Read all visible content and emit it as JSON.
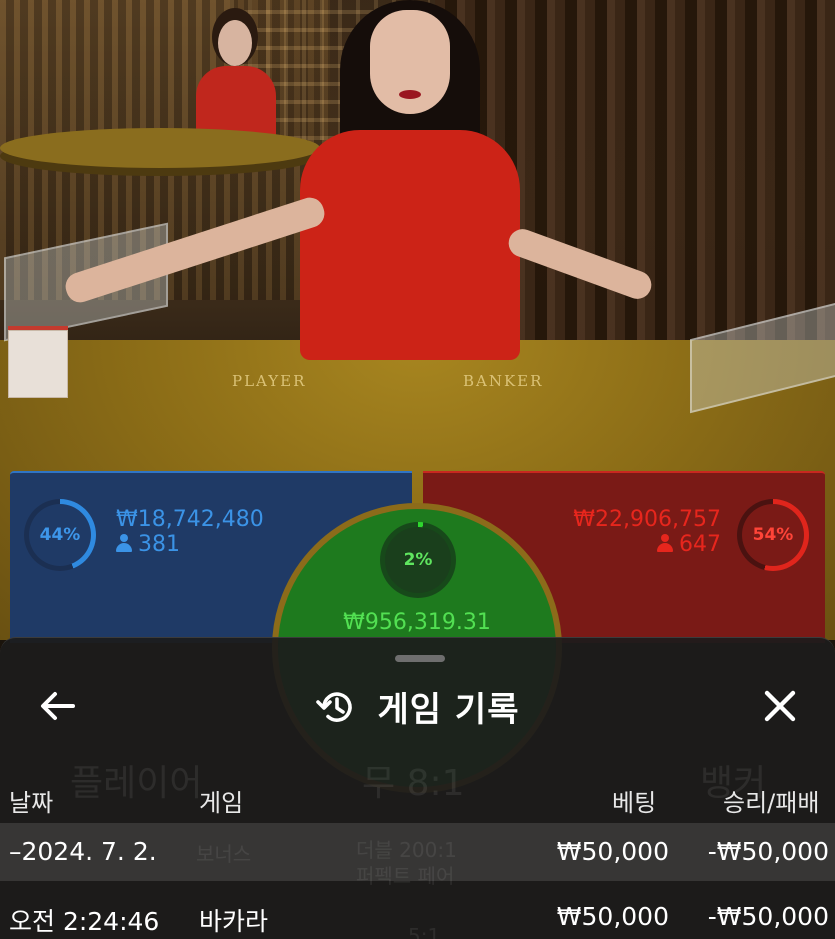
{
  "table_labels": {
    "player": "PLAYER",
    "banker": "BANKER"
  },
  "player": {
    "percent": "44%",
    "amount": "₩18,742,480",
    "count": "381",
    "color": "#3b93e6"
  },
  "banker": {
    "percent": "54%",
    "amount": "₩22,906,757",
    "count": "647",
    "color": "#e7261d"
  },
  "tie": {
    "percent": "2%",
    "amount": "₩956,319.31",
    "color": "#52e052"
  },
  "history": {
    "title": "게임 기록",
    "icons": {
      "back": "arrow-left-icon",
      "history": "history-clock-icon",
      "close": "close-icon"
    },
    "background_labels": [
      "플레이어",
      "무 8:1",
      "뱅커",
      "더블 200:1",
      "퍼펙트 페어",
      "보너스",
      "5:1"
    ],
    "columns": {
      "date": "날짜",
      "game": "게임",
      "bet": "베팅",
      "result": "승리/패배"
    },
    "rows": [
      {
        "date": "–2024. 7. 2.",
        "game": "",
        "bet": "₩50,000",
        "result": "-₩50,000",
        "selected": true
      },
      {
        "date": "오전 2:24:46",
        "game": "바카라",
        "bet": "₩50,000",
        "result": "-₩50,000",
        "selected": false
      }
    ]
  }
}
